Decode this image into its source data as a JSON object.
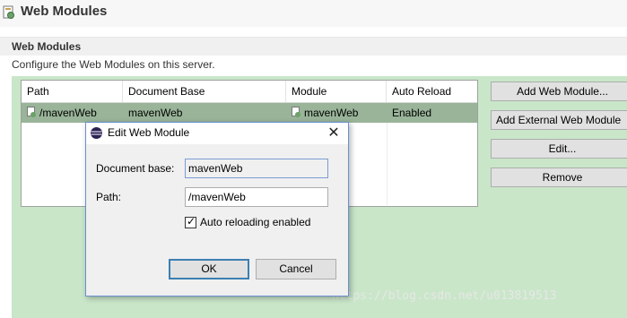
{
  "page": {
    "title": "Web Modules",
    "icon": "server-module-icon"
  },
  "section": {
    "title": "Web Modules",
    "description": "Configure the Web Modules on this server."
  },
  "table": {
    "columns": [
      "Path",
      "Document Base",
      "Module",
      "Auto Reload"
    ],
    "rows": [
      {
        "path": "/mavenWeb",
        "document_base": "mavenWeb",
        "module": "mavenWeb",
        "auto_reload": "Enabled"
      }
    ],
    "selected_row_color": "#99b499"
  },
  "buttons": {
    "add": "Add Web Module...",
    "add_external": "Add External Web Module",
    "edit": "Edit...",
    "remove": "Remove"
  },
  "dialog": {
    "title": "Edit Web Module",
    "close_glyph": "✕",
    "document_base_label": "Document base:",
    "document_base_value": "mavenWeb",
    "path_label": "Path:",
    "path_value": "/mavenWeb",
    "auto_reload_label": "Auto reloading enabled",
    "auto_reload_checked": true,
    "check_glyph": "✓",
    "ok": "OK",
    "cancel": "Cancel"
  },
  "watermark": "https://blog.csdn.net/u013819513",
  "colors": {
    "panel_green": "#c9e6c9",
    "dialog_border": "#6a8fcf"
  }
}
